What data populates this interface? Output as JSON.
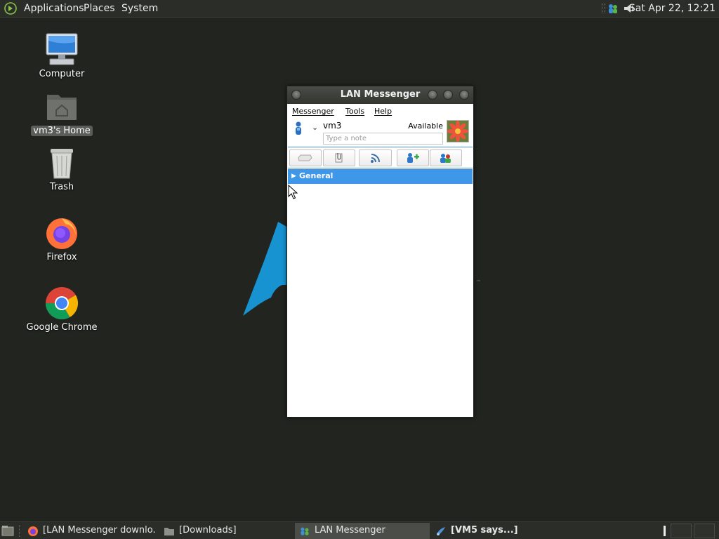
{
  "top_panel": {
    "menus": [
      "Applications",
      "Places",
      "System"
    ],
    "clock": "Sat Apr 22, 12:21",
    "tray_icons": [
      "lan-messenger-tray-icon",
      "volume-icon"
    ]
  },
  "desktop": {
    "icons": [
      {
        "label": "Computer",
        "icon": "computer-icon"
      },
      {
        "label": "vm3's Home",
        "icon": "home-folder-icon",
        "selected": true
      },
      {
        "label": "Trash",
        "icon": "trash-icon"
      },
      {
        "label": "Firefox",
        "icon": "firefox-icon"
      },
      {
        "label": "Google Chrome",
        "icon": "chrome-icon"
      }
    ],
    "wallpaper_tm": "™"
  },
  "window": {
    "title": "LAN Messenger",
    "menus": [
      "Messenger",
      "Tools",
      "Help"
    ],
    "user": {
      "name": "vm3",
      "status": "Available",
      "note_placeholder": "Type a note",
      "avatar": "flower-avatar"
    },
    "toolbar": [
      "broadcast-button",
      "attach-button",
      "rss-button",
      "add-contact-button",
      "settings-button"
    ],
    "groups": [
      {
        "name": "General",
        "expanded": false
      }
    ],
    "colors": {
      "selection": "#3e97e9",
      "toolbar_border": "#4a90d9"
    }
  },
  "taskbar": {
    "tasks": [
      {
        "label": "[LAN Messenger downlo...",
        "icon": "firefox-icon",
        "active": false,
        "bold": false
      },
      {
        "label": "[Downloads]",
        "icon": "folder-icon",
        "active": false,
        "bold": false
      },
      {
        "label": "LAN Messenger",
        "icon": "lan-messenger-icon",
        "active": true,
        "bold": false
      },
      {
        "label": "[VM5 says...]",
        "icon": "chat-icon",
        "active": false,
        "bold": true
      }
    ]
  }
}
